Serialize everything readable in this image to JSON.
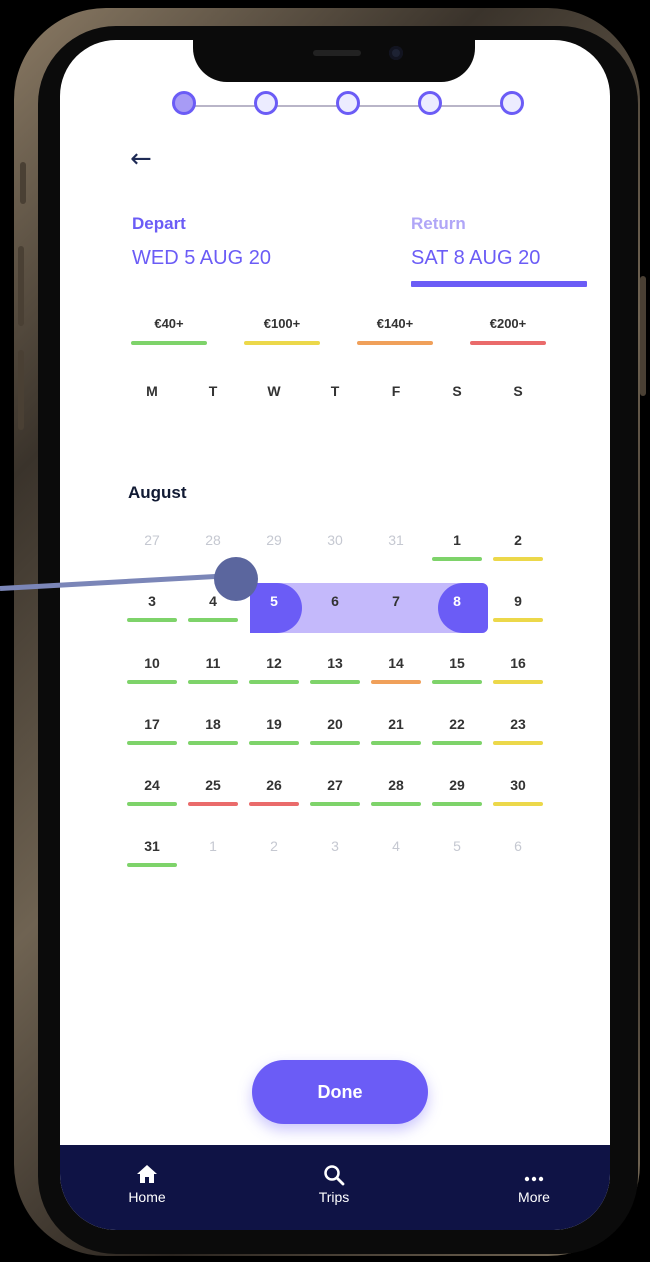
{
  "stepper": {
    "total_steps": 5,
    "active_step": 1
  },
  "dates": {
    "depart_label": "Depart",
    "depart_value": "WED 5 AUG 20",
    "return_label": "Return",
    "return_value": "SAT 8 AUG 20"
  },
  "price_legend": [
    {
      "label": "€40+",
      "color": "#7ed36a"
    },
    {
      "label": "€100+",
      "color": "#ecd84a"
    },
    {
      "label": "€140+",
      "color": "#f0a05a"
    },
    {
      "label": "€200+",
      "color": "#ea6b6b"
    }
  ],
  "weekdays": [
    "M",
    "T",
    "W",
    "T",
    "F",
    "S",
    "S"
  ],
  "calendar": {
    "month": "August",
    "selection": {
      "start": "5",
      "end": "8"
    },
    "weeks": [
      [
        {
          "d": "27",
          "muted": true
        },
        {
          "d": "28",
          "muted": true
        },
        {
          "d": "29",
          "muted": true
        },
        {
          "d": "30",
          "muted": true
        },
        {
          "d": "31",
          "muted": true
        },
        {
          "d": "1",
          "price": "green"
        },
        {
          "d": "2",
          "price": "yellow"
        }
      ],
      [
        {
          "d": "3",
          "price": "green"
        },
        {
          "d": "4",
          "price": "green"
        },
        {
          "d": "5",
          "selected": true
        },
        {
          "d": "6",
          "in_range": true
        },
        {
          "d": "7",
          "in_range": true
        },
        {
          "d": "8",
          "selected": true
        },
        {
          "d": "9",
          "price": "yellow"
        }
      ],
      [
        {
          "d": "10",
          "price": "green"
        },
        {
          "d": "11",
          "price": "green"
        },
        {
          "d": "12",
          "price": "green"
        },
        {
          "d": "13",
          "price": "green"
        },
        {
          "d": "14",
          "price": "orange"
        },
        {
          "d": "15",
          "price": "green"
        },
        {
          "d": "16",
          "price": "yellow"
        }
      ],
      [
        {
          "d": "17",
          "price": "green"
        },
        {
          "d": "18",
          "price": "green"
        },
        {
          "d": "19",
          "price": "green"
        },
        {
          "d": "20",
          "price": "green"
        },
        {
          "d": "21",
          "price": "green"
        },
        {
          "d": "22",
          "price": "green"
        },
        {
          "d": "23",
          "price": "yellow"
        }
      ],
      [
        {
          "d": "24",
          "price": "green"
        },
        {
          "d": "25",
          "price": "red"
        },
        {
          "d": "26",
          "price": "red"
        },
        {
          "d": "27",
          "price": "green"
        },
        {
          "d": "28",
          "price": "green"
        },
        {
          "d": "29",
          "price": "green"
        },
        {
          "d": "30",
          "price": "yellow"
        }
      ],
      [
        {
          "d": "31",
          "price": "green"
        },
        {
          "d": "1",
          "muted": true
        },
        {
          "d": "2",
          "muted": true
        },
        {
          "d": "3",
          "muted": true
        },
        {
          "d": "4",
          "muted": true
        },
        {
          "d": "5",
          "muted": true
        },
        {
          "d": "6",
          "muted": true
        }
      ]
    ]
  },
  "price_colors": {
    "green": "#7ed36a",
    "yellow": "#ecd84a",
    "orange": "#f0a05a",
    "red": "#ea6b6b"
  },
  "actions": {
    "done_label": "Done"
  },
  "nav": {
    "home": {
      "label": "Home",
      "icon": "home-icon"
    },
    "trips": {
      "label": "Trips",
      "icon": "search-icon"
    },
    "more": {
      "label": "More",
      "icon": "more-icon"
    }
  },
  "colors": {
    "accent": "#6b5cf6",
    "range": "#c4b9fb",
    "nav_bg": "#0f1345"
  }
}
